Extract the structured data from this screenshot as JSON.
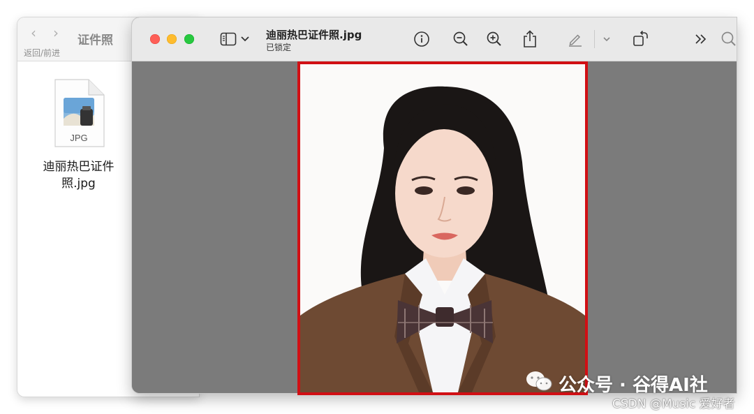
{
  "finder": {
    "title": "证件照",
    "nav_label": "返回/前进",
    "file": {
      "type_label": "JPG",
      "name": "迪丽热巴证件照.jpg"
    }
  },
  "preview": {
    "doc_title": "迪丽热巴证件照.jpg",
    "doc_status": "已锁定",
    "toolbar_icons": [
      "sidebar-toggle-icon",
      "chevron-down-icon",
      "info-icon",
      "zoom-out-icon",
      "zoom-in-icon",
      "share-icon",
      "markup-pen-icon",
      "chevron-down-icon",
      "rotate-icon",
      "more-chevrons-icon",
      "search-icon"
    ],
    "selection_color": "#d10f14"
  },
  "watermarks": {
    "wechat": "公众号 · 谷得AI社",
    "csdn": "CSDN @Music 爱好者"
  },
  "colors": {
    "close": "#fe5f57",
    "minimize": "#febc2e",
    "maximize": "#28c840",
    "canvas": "#7b7b7b"
  }
}
